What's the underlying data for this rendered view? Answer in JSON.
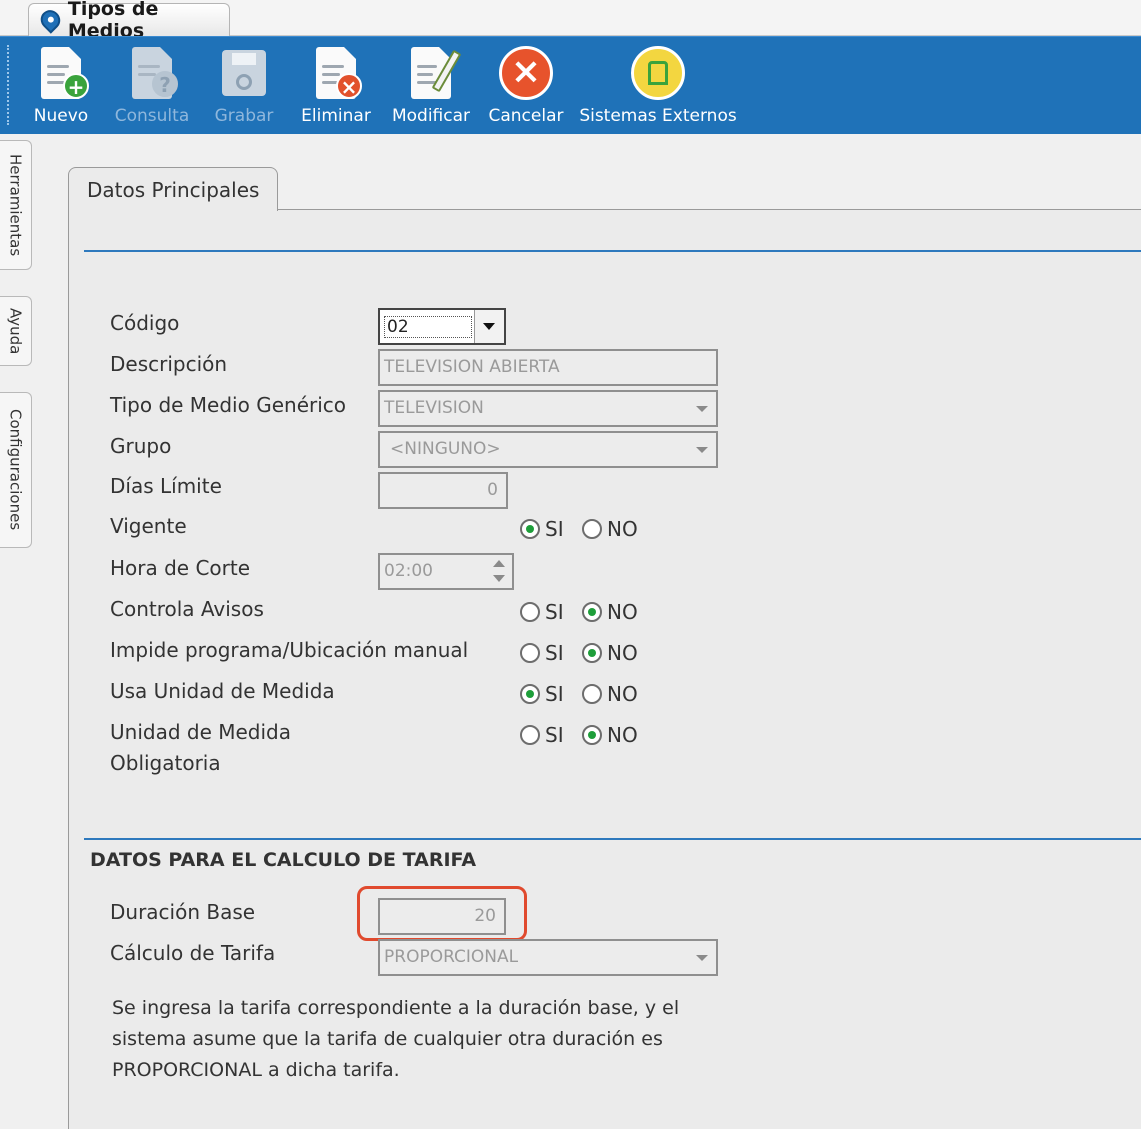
{
  "window_tab": {
    "title": "Tipos de Medios"
  },
  "toolbar": {
    "nuevo": "Nuevo",
    "consulta": "Consulta",
    "grabar": "Grabar",
    "eliminar": "Eliminar",
    "modificar": "Modificar",
    "cancelar": "Cancelar",
    "sistemas_externos": "Sistemas Externos"
  },
  "side_tabs": [
    "Herramientas",
    "Ayuda",
    "Configuraciones"
  ],
  "content_tab": {
    "label": "Datos Principales"
  },
  "form": {
    "codigo": {
      "label": "Código",
      "value": "02"
    },
    "descripcion": {
      "label": "Descripción",
      "value": "TELEVISION ABIERTA"
    },
    "tipo_medio_generico": {
      "label": "Tipo de Medio Genérico",
      "value": "TELEVISION"
    },
    "grupo": {
      "label": "Grupo",
      "value": "<NINGUNO>"
    },
    "dias_limite": {
      "label": "Días Límite",
      "value": "0"
    },
    "vigente": {
      "label": "Vigente",
      "selected": "SI"
    },
    "hora_corte": {
      "label": "Hora de Corte",
      "value": "02:00"
    },
    "controla_avisos": {
      "label": "Controla Avisos",
      "selected": "NO"
    },
    "impide_programa": {
      "label": "Impide programa/Ubicación manual",
      "selected": "NO"
    },
    "usa_unidad_medida": {
      "label": "Usa Unidad de Medida",
      "selected": "SI"
    },
    "unidad_medida_obligatoria": {
      "label_line1": "Unidad de Medida",
      "label_line2": "Obligatoria",
      "selected": "NO"
    },
    "option_si": "SI",
    "option_no": "NO"
  },
  "tarifa": {
    "section_title": "DATOS PARA EL CALCULO DE TARIFA",
    "duracion_base": {
      "label": "Duración Base",
      "value": "20"
    },
    "calculo_tarifa": {
      "label": "Cálculo de Tarifa",
      "value": "PROPORCIONAL"
    },
    "description_line1": "Se ingresa la tarifa correspondiente a la duración base, y el",
    "description_line2": "sistema asume que la tarifa de cualquier otra duración es",
    "description_line3": "PROPORCIONAL a dicha tarifa."
  }
}
